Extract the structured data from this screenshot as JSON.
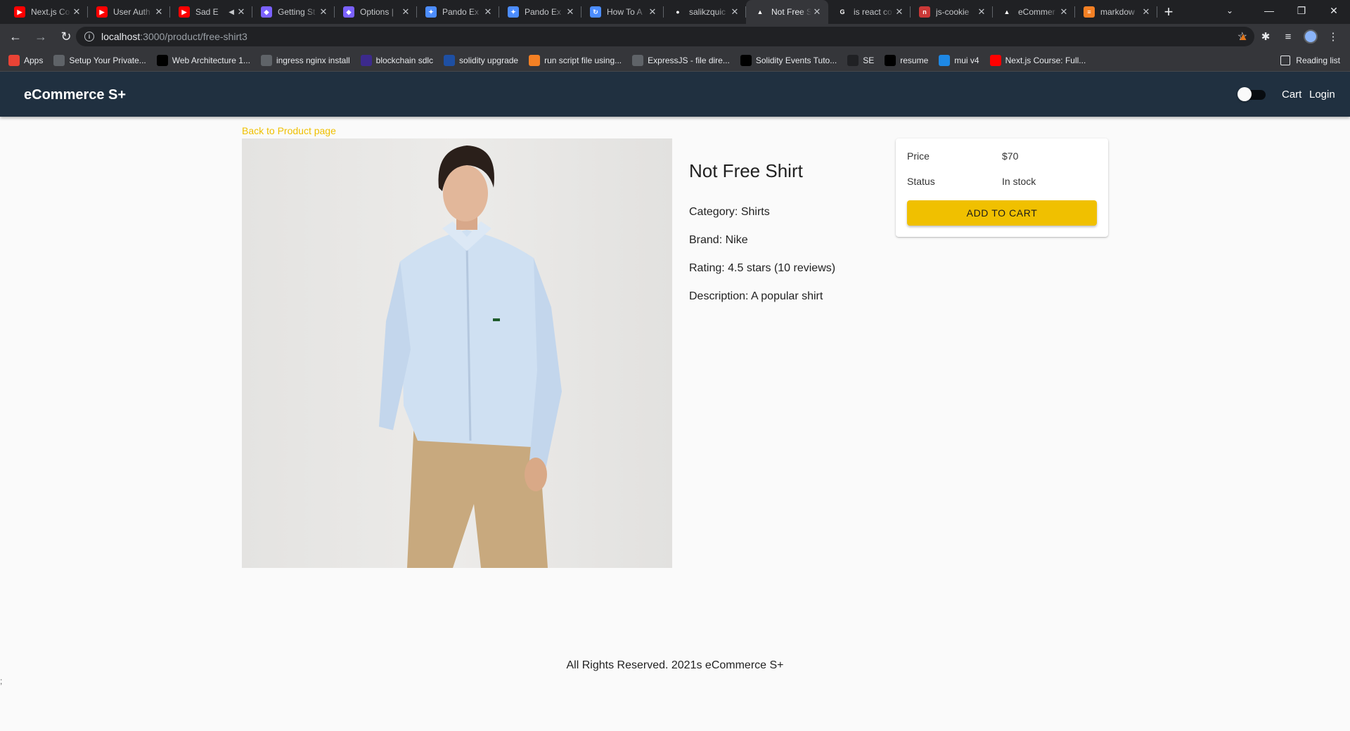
{
  "browser": {
    "tabs": [
      {
        "title": "Next.js Co",
        "icon": "youtube-icon",
        "color": "#ff0000"
      },
      {
        "title": "User Auth",
        "icon": "youtube-icon",
        "color": "#ff0000"
      },
      {
        "title": "Sad E",
        "icon": "youtube-icon",
        "color": "#ff0000"
      },
      {
        "title": "Getting St",
        "icon": "shield-icon",
        "color": "#7b61ff"
      },
      {
        "title": "Options |",
        "icon": "shield-icon",
        "color": "#7b61ff"
      },
      {
        "title": "Pando Ex",
        "icon": "pando-icon",
        "color": "#4c8dff"
      },
      {
        "title": "Pando Ex",
        "icon": "pando-icon",
        "color": "#4c8dff"
      },
      {
        "title": "How To A",
        "icon": "spinner-icon",
        "color": "#4c8dff"
      },
      {
        "title": "salikzquic",
        "icon": "github-icon",
        "color": "#ffffff"
      },
      {
        "title": "Not Free S",
        "icon": "triangle-icon",
        "color": "#ffffff"
      },
      {
        "title": "is react co",
        "icon": "google-icon",
        "color": "#ffffff"
      },
      {
        "title": "js-cookie",
        "icon": "npm-icon",
        "color": "#cb3837"
      },
      {
        "title": "eCommer",
        "icon": "triangle-icon",
        "color": "#ffffff"
      },
      {
        "title": "markdow",
        "icon": "stackoverflow-icon",
        "color": "#f48024"
      }
    ],
    "url_host": "localhost",
    "url_path": ":3000/product/free-shirt3",
    "bookmarks": [
      {
        "label": "Apps",
        "color": "#ea4335"
      },
      {
        "label": "Setup Your Private...",
        "color": "#5f6368"
      },
      {
        "label": "Web Architecture 1...",
        "color": "#000000"
      },
      {
        "label": "ingress nginx install",
        "color": "#5f6368"
      },
      {
        "label": "blockchain sdlc",
        "color": "#3c2a8c"
      },
      {
        "label": "solidity upgrade",
        "color": "#1e4fa3"
      },
      {
        "label": "run script file using...",
        "color": "#f48024"
      },
      {
        "label": "ExpressJS - file dire...",
        "color": "#5f6368"
      },
      {
        "label": "Solidity Events Tuto...",
        "color": "#000000"
      },
      {
        "label": "SE",
        "color": "#202124"
      },
      {
        "label": "resume",
        "color": "#000000"
      },
      {
        "label": "mui v4",
        "color": "#1e88e5"
      },
      {
        "label": "Next.js Course: Full...",
        "color": "#ff0000"
      }
    ],
    "reading_list": "Reading list"
  },
  "navbar": {
    "brand": "eCommerce S+",
    "cart": "Cart",
    "login": "Login",
    "bg_color": "#203040"
  },
  "page": {
    "back_link": "Back to Product page",
    "product": {
      "name": "Not Free Shirt",
      "category": "Category: Shirts",
      "brand": "Brand: Nike",
      "rating": "Rating: 4.5 stars (10 reviews)",
      "description": "Description: A popular shirt"
    },
    "card": {
      "price_label": "Price",
      "price_value": "$70",
      "status_label": "Status",
      "status_value": "In stock",
      "add_to_cart": "ADD TO CART"
    },
    "accent_color": "#f0c000",
    "footer": "All Rights Reserved. 2021s eCommerce S+",
    "stray_text": ";"
  }
}
